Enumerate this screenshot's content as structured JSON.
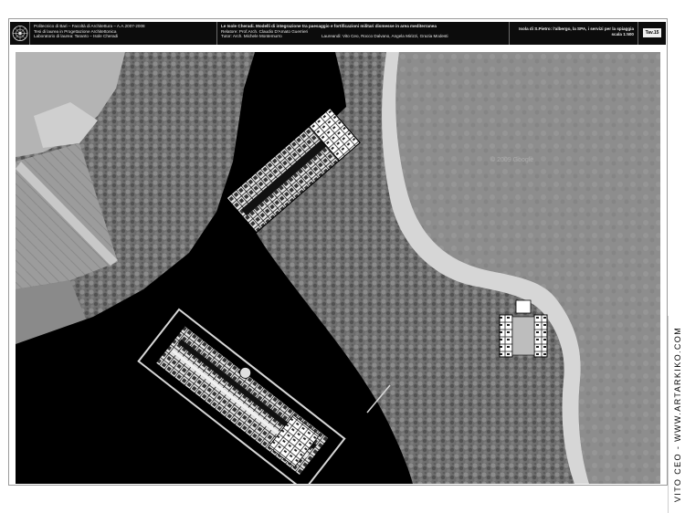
{
  "title_block": {
    "info_lines": [
      "Politecnico di Bari – Facoltà di Architettura – A.A.2007-2008",
      "Tesi di laurea in Progettazione Architettonica",
      "Laboratorio di laurea: Taranto – Isole Cheradi"
    ],
    "project_title": "Le Isole Cheradi. Modelli di integrazione tra paesaggio e fortificazioni militari dismesse in area mediterranea",
    "supervisor": "Relatore: Prof.Arch. Claudio D'Amato Guerrieri",
    "tutor": "Tutor: Arch. Michele Montemurro",
    "students": "Laureandi: Vito Ceo, Rocco Dalvano, Angela Mirizzi, Grazia Modesti",
    "sheet_title": "Isola di S.Pietro: l'albergo, la SPA, i servizi per la spiaggia",
    "scale": "scala 1:500",
    "sheet_number": "Tav.15"
  },
  "map": {
    "watermark": "© 2009 Google"
  },
  "watermark_side": "VITO CEO - WWW.ARTARKIKO.COM"
}
